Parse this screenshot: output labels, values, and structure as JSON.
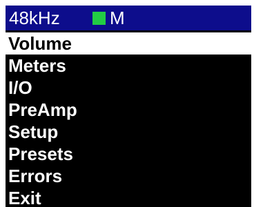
{
  "status": {
    "sample_rate": "48kHz",
    "indicator_color": "#22cc44",
    "mode": "M"
  },
  "menu": {
    "selected_index": 0,
    "items": [
      {
        "label": "Volume"
      },
      {
        "label": "Meters"
      },
      {
        "label": "I/O"
      },
      {
        "label": "PreAmp"
      },
      {
        "label": "Setup"
      },
      {
        "label": "Presets"
      },
      {
        "label": "Errors"
      },
      {
        "label": "Exit"
      }
    ]
  },
  "colors": {
    "status_bar_bg": "#0d0d8c",
    "screen_bg": "#000000",
    "selected_bg": "#ffffff"
  }
}
